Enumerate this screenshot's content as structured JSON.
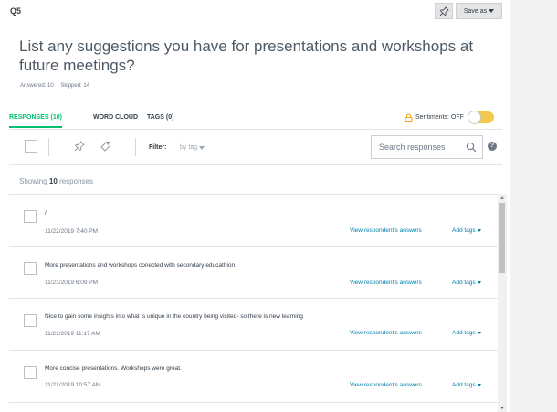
{
  "question": {
    "number": "Q5",
    "title": "List any suggestions you have for presentations and workshops at future meetings?",
    "answered": "Answered: 10",
    "skipped": "Skipped: 14"
  },
  "actions": {
    "pin_icon": "pin-icon",
    "save_as_label": "Save as"
  },
  "tabs": [
    {
      "label": "RESPONSES (10)",
      "active": true
    },
    {
      "label": "WORD CLOUD",
      "active": false
    },
    {
      "label": "TAGS (0)",
      "active": false
    }
  ],
  "sentiments": {
    "label": "Sentiments: OFF",
    "enabled": false
  },
  "toolbar": {
    "filter_label": "Filter:",
    "filter_value": "by tag",
    "search_placeholder": "Search responses",
    "help": "?"
  },
  "showing": {
    "prefix": "Showing",
    "count": "10",
    "suffix": "responses"
  },
  "links": {
    "view_answers": "View respondent's answers",
    "add_tags": "Add tags"
  },
  "responses": [
    {
      "text": "/",
      "date": "11/22/2019 7:40 PM"
    },
    {
      "text": "More presentations and workshops conected with secondary educathion.",
      "date": "11/21/2019 6:09 PM"
    },
    {
      "text": "Nice to gain some insights into what is unique in the country being visited- so there is new learning",
      "date": "11/21/2019 11:17 AM"
    },
    {
      "text": "More concise presentations. Workshops were great.",
      "date": "11/21/2019 10:57 AM"
    }
  ],
  "colors": {
    "accent_green": "#00bf6f",
    "link_blue": "#007faa",
    "toggle_yellow": "#f2c94c",
    "lock_orange": "#f0a30a"
  }
}
